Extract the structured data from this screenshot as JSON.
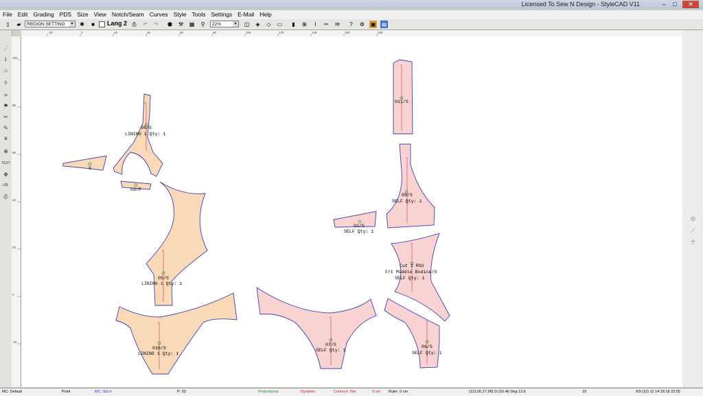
{
  "window": {
    "title": "Licensed To Sew N Design - StyleCAD V11",
    "min_label": "–",
    "max_label": "□",
    "close_label": "✕"
  },
  "menu": [
    "File",
    "Edit",
    "Grading",
    "PDS",
    "Size",
    "View",
    "Notch/Seam",
    "Curves",
    "Style",
    "Tools",
    "Settings",
    "E-Mail",
    "Help"
  ],
  "toolbar": {
    "region_select": "REGION SETTING",
    "lang": "Lang 2",
    "zoom": "22%"
  },
  "ruler": {
    "h_ticks": [
      "-20",
      "0",
      "20",
      "40",
      "60",
      "80",
      "100",
      "120",
      "140",
      "160",
      "180"
    ],
    "v_ticks": [
      "100",
      "80",
      "60",
      "40",
      "20",
      "0",
      "-20"
    ]
  },
  "pieces": [
    {
      "id": "p01",
      "label": [
        "08/S",
        "LINING 1 Qty: 1"
      ]
    },
    {
      "id": "p02",
      "label": [
        "S"
      ]
    },
    {
      "id": "p03",
      "label": [
        "03/P"
      ]
    },
    {
      "id": "p04",
      "label": [
        "05/S",
        "LINING 1 Qty: 1"
      ]
    },
    {
      "id": "p05",
      "label": [
        "010/S",
        "LINING 1 Qty: 1"
      ]
    },
    {
      "id": "p06",
      "label": [
        "011/S"
      ]
    },
    {
      "id": "p07",
      "label": [
        "09/S",
        "SELF Qty: 1"
      ]
    },
    {
      "id": "p08",
      "label": [
        "03/S",
        "SELF Qty: 1"
      ]
    },
    {
      "id": "p09",
      "label": [
        "Cut 1 RSU",
        "Frt Middle Bodice/S",
        "SELF Qty: 1"
      ]
    },
    {
      "id": "p10",
      "label": [
        "07/S",
        "SELF Qty: 1"
      ]
    },
    {
      "id": "p11",
      "label": [
        "06/S",
        "SELF Qty: 1"
      ]
    }
  ],
  "status": {
    "mc": "MC: Default",
    "point": "Point",
    "self": "MC: SELF",
    "piece": "P: 03",
    "prop": "Proportional",
    "dyn": "Dynamic",
    "connect": "Connect: Yes",
    "unit": "0 cm",
    "ruler": "Ruler: 0 cm",
    "coords": "(113.00,27.98)  D:116.46  Deg:13.6",
    "num": "19",
    "datetime": "9/9 (10) 12 14:18:18 22:05"
  },
  "colors": {
    "outline": "#3f3fb0",
    "fill_lining": "#f9d9b7",
    "fill_self": "#f9d2d2",
    "grain": "#c23a5a"
  }
}
